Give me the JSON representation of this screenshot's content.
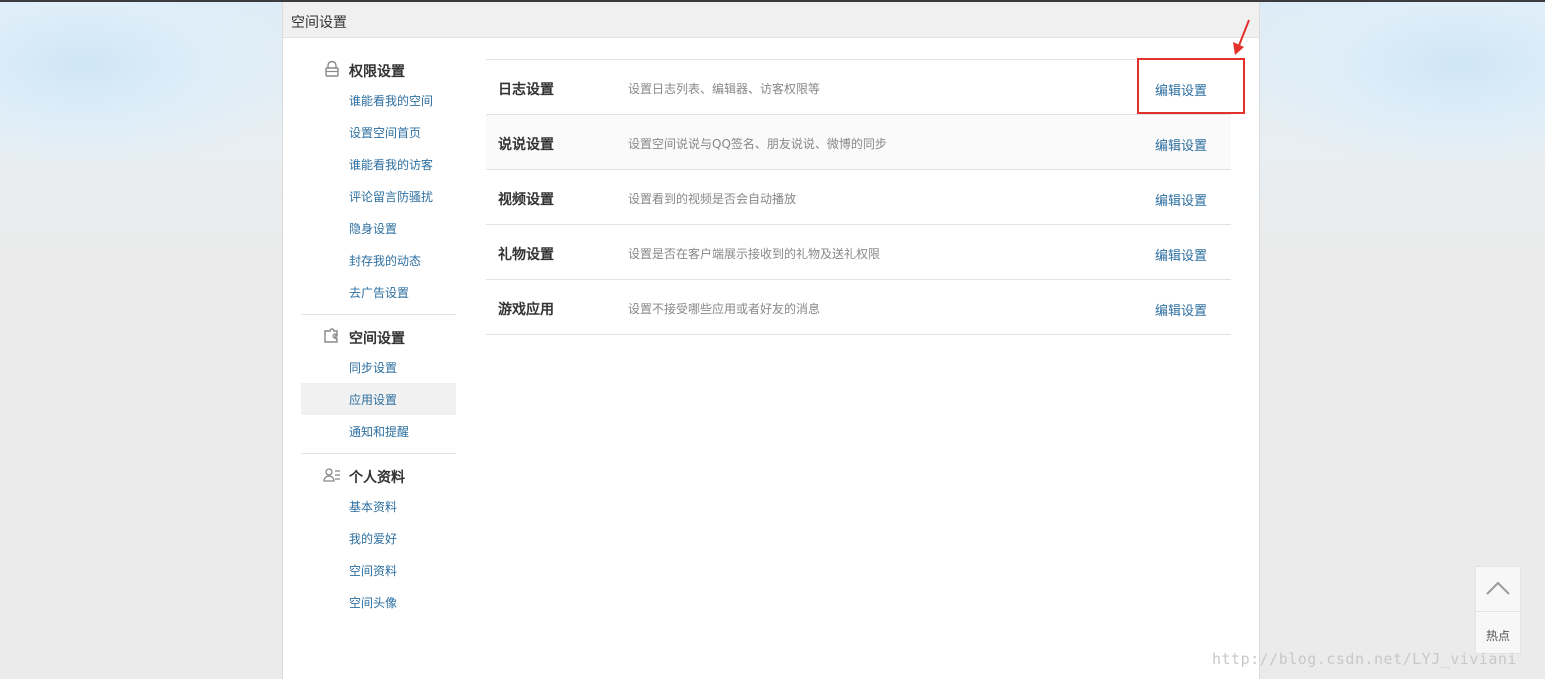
{
  "panel": {
    "title": "空间设置"
  },
  "sidebar": {
    "groups": [
      {
        "title": "权限设置",
        "icon": "lock-icon",
        "items": [
          "谁能看我的空间",
          "设置空间首页",
          "谁能看我的访客",
          "评论留言防骚扰",
          "隐身设置",
          "封存我的动态",
          "去广告设置"
        ]
      },
      {
        "title": "空间设置",
        "icon": "puzzle-icon",
        "items": [
          "同步设置",
          "应用设置",
          "通知和提醒"
        ],
        "active_item": "应用设置"
      },
      {
        "title": "个人资料",
        "icon": "profile-card-icon",
        "items": [
          "基本资料",
          "我的爱好",
          "空间资料",
          "空间头像"
        ]
      }
    ]
  },
  "settings_rows": [
    {
      "title": "日志设置",
      "desc": "设置日志列表、编辑器、访客权限等",
      "link": "编辑设置"
    },
    {
      "title": "说说设置",
      "desc": "设置空间说说与QQ签名、朋友说说、微博的同步",
      "link": "编辑设置"
    },
    {
      "title": "视频设置",
      "desc": "设置看到的视频是否会自动播放",
      "link": "编辑设置"
    },
    {
      "title": "礼物设置",
      "desc": "设置是否在客户端展示接收到的礼物及送礼权限",
      "link": "编辑设置"
    },
    {
      "title": "游戏应用",
      "desc": "设置不接受哪些应用或者好友的消息",
      "link": "编辑设置"
    }
  ],
  "hot_widget": {
    "label": "热点",
    "icon": "chevron-up-icon"
  },
  "watermark": "http://blog.csdn.net/LYJ_viviani",
  "colors": {
    "link": "#2d6fa0",
    "annotation": "#e3302a"
  }
}
